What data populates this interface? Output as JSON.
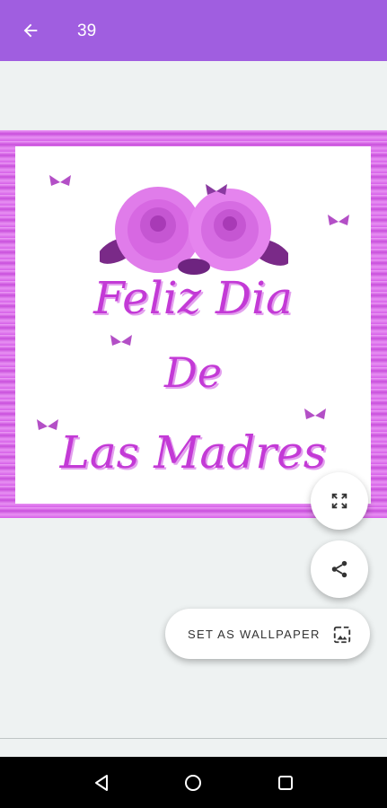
{
  "header": {
    "title": "39",
    "back_icon": "arrow-back-icon",
    "background": "#a05ee0"
  },
  "image": {
    "greeting_line1": "Feliz Dia",
    "greeting_line2": "De",
    "greeting_line3": "Las Madres",
    "decorations": [
      "roses",
      "butterflies"
    ],
    "frame_color": "#d660e8",
    "text_color": "#c33ad6"
  },
  "actions": {
    "expand_icon": "fullscreen-icon",
    "share_icon": "share-icon",
    "set_wallpaper_label": "SET AS WALLPAPER",
    "wallpaper_icon": "wallpaper-icon"
  },
  "system_nav": {
    "icons": [
      "nav-back-icon",
      "nav-home-icon",
      "nav-recents-icon"
    ]
  }
}
